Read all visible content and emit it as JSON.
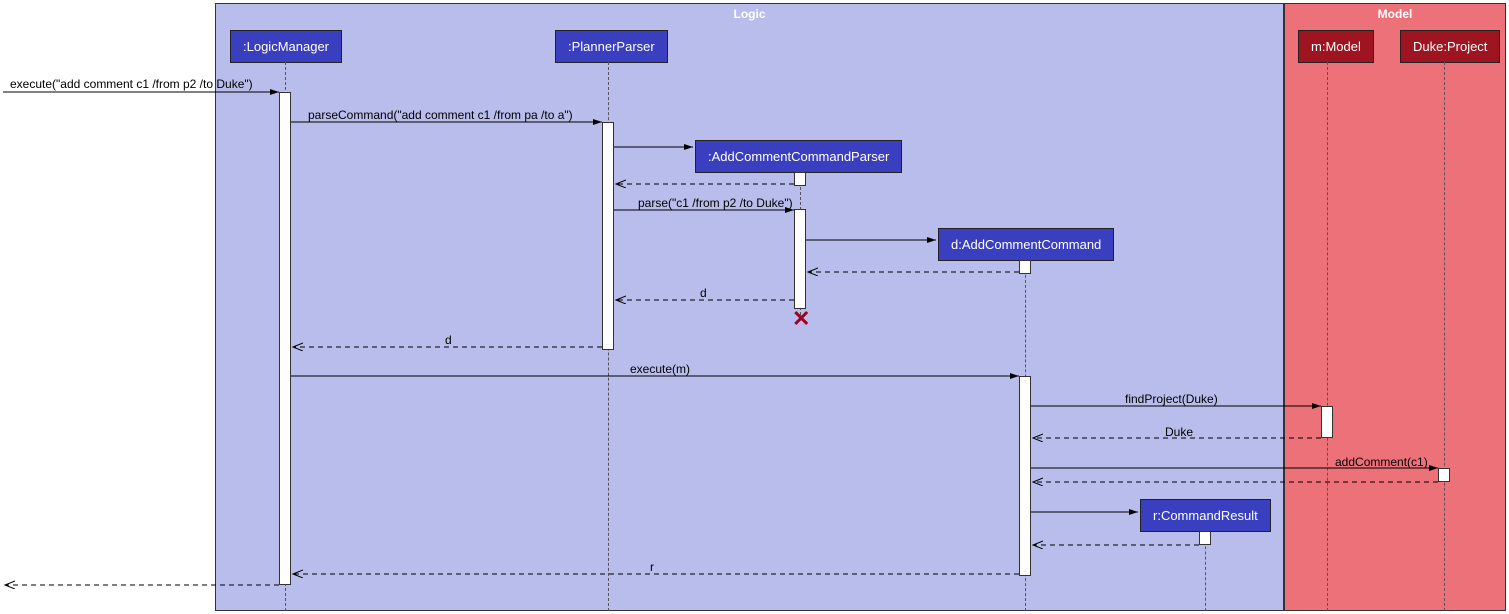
{
  "frames": {
    "logic": "Logic",
    "model": "Model"
  },
  "participants": {
    "logicManager": ":LogicManager",
    "plannerParser": ":PlannerParser",
    "addCommentCommandParser": ":AddCommentCommandParser",
    "addCommentCommand": "d:AddCommentCommand",
    "commandResult": "r:CommandResult",
    "model": "m:Model",
    "dukeProject": "Duke:Project"
  },
  "messages": {
    "execute1": "execute(\"add comment c1 /from p2 /to Duke\")",
    "parseCommand": "parseCommand(\"add comment c1 /from pa /to a\")",
    "parse": "parse(\"c1 /from p2 /to Duke\")",
    "returnD1": "d",
    "returnD2": "d",
    "executeM": "execute(m)",
    "findProject": "findProject(Duke)",
    "returnDuke": "Duke",
    "addComment": "addComment(c1)",
    "returnR": "r"
  }
}
